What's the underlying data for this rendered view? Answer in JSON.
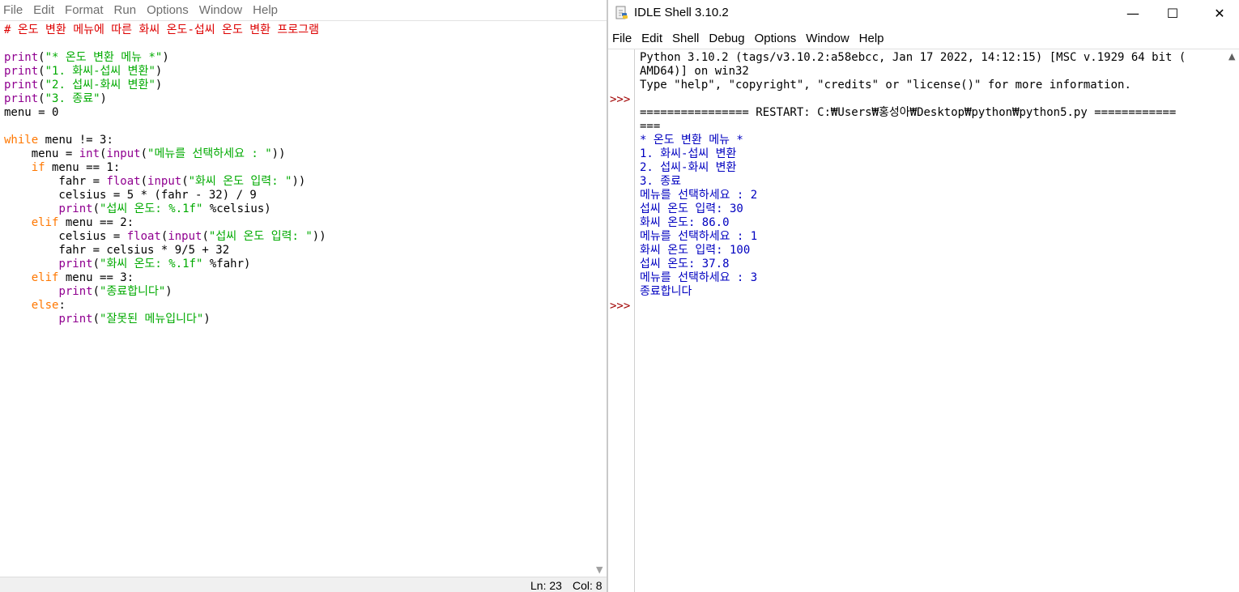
{
  "editor": {
    "menu": [
      "File",
      "Edit",
      "Format",
      "Run",
      "Options",
      "Window",
      "Help"
    ],
    "lines": [
      [
        {
          "t": "# 온도 변환 메뉴에 따른 화씨 온도-섭씨 온도 변환 프로그램",
          "c": "cm"
        }
      ],
      [],
      [
        {
          "t": "print",
          "c": "bi"
        },
        {
          "t": "(",
          "c": "df"
        },
        {
          "t": "\"* 온도 변환 메뉴 *\"",
          "c": "st"
        },
        {
          "t": ")",
          "c": "df"
        }
      ],
      [
        {
          "t": "print",
          "c": "bi"
        },
        {
          "t": "(",
          "c": "df"
        },
        {
          "t": "\"1. 화씨-섭씨 변환\"",
          "c": "st"
        },
        {
          "t": ")",
          "c": "df"
        }
      ],
      [
        {
          "t": "print",
          "c": "bi"
        },
        {
          "t": "(",
          "c": "df"
        },
        {
          "t": "\"2. 섭씨-화씨 변환\"",
          "c": "st"
        },
        {
          "t": ")",
          "c": "df"
        }
      ],
      [
        {
          "t": "print",
          "c": "bi"
        },
        {
          "t": "(",
          "c": "df"
        },
        {
          "t": "\"3. 종료\"",
          "c": "st"
        },
        {
          "t": ")",
          "c": "df"
        }
      ],
      [
        {
          "t": "menu = 0",
          "c": "df"
        }
      ],
      [],
      [
        {
          "t": "while",
          "c": "kw"
        },
        {
          "t": " menu != 3:",
          "c": "df"
        }
      ],
      [
        {
          "t": "    menu = ",
          "c": "df"
        },
        {
          "t": "int",
          "c": "bi"
        },
        {
          "t": "(",
          "c": "df"
        },
        {
          "t": "input",
          "c": "bi"
        },
        {
          "t": "(",
          "c": "df"
        },
        {
          "t": "\"메뉴를 선택하세요 : \"",
          "c": "st"
        },
        {
          "t": "))",
          "c": "df"
        }
      ],
      [
        {
          "t": "    ",
          "c": "df"
        },
        {
          "t": "if",
          "c": "kw"
        },
        {
          "t": " menu == 1:",
          "c": "df"
        }
      ],
      [
        {
          "t": "        fahr = ",
          "c": "df"
        },
        {
          "t": "float",
          "c": "bi"
        },
        {
          "t": "(",
          "c": "df"
        },
        {
          "t": "input",
          "c": "bi"
        },
        {
          "t": "(",
          "c": "df"
        },
        {
          "t": "\"화씨 온도 입력: \"",
          "c": "st"
        },
        {
          "t": "))",
          "c": "df"
        }
      ],
      [
        {
          "t": "        celsius = 5 * (fahr - 32) / 9",
          "c": "df"
        }
      ],
      [
        {
          "t": "        ",
          "c": "df"
        },
        {
          "t": "print",
          "c": "bi"
        },
        {
          "t": "(",
          "c": "df"
        },
        {
          "t": "\"섭씨 온도: %.1f\"",
          "c": "st"
        },
        {
          "t": " %celsius)",
          "c": "df"
        }
      ],
      [
        {
          "t": "    ",
          "c": "df"
        },
        {
          "t": "elif",
          "c": "kw"
        },
        {
          "t": " menu == 2:",
          "c": "df"
        }
      ],
      [
        {
          "t": "        celsius = ",
          "c": "df"
        },
        {
          "t": "float",
          "c": "bi"
        },
        {
          "t": "(",
          "c": "df"
        },
        {
          "t": "input",
          "c": "bi"
        },
        {
          "t": "(",
          "c": "df"
        },
        {
          "t": "\"섭씨 온도 입력: \"",
          "c": "st"
        },
        {
          "t": "))",
          "c": "df"
        }
      ],
      [
        {
          "t": "        fahr = celsius * 9/5 + 32",
          "c": "df"
        }
      ],
      [
        {
          "t": "        ",
          "c": "df"
        },
        {
          "t": "print",
          "c": "bi"
        },
        {
          "t": "(",
          "c": "df"
        },
        {
          "t": "\"화씨 온도: %.1f\"",
          "c": "st"
        },
        {
          "t": " %fahr)",
          "c": "df"
        }
      ],
      [
        {
          "t": "    ",
          "c": "df"
        },
        {
          "t": "elif",
          "c": "kw"
        },
        {
          "t": " menu == 3:",
          "c": "df"
        }
      ],
      [
        {
          "t": "        ",
          "c": "df"
        },
        {
          "t": "print",
          "c": "bi"
        },
        {
          "t": "(",
          "c": "df"
        },
        {
          "t": "\"종료합니다\"",
          "c": "st"
        },
        {
          "t": ")",
          "c": "df"
        }
      ],
      [
        {
          "t": "    ",
          "c": "df"
        },
        {
          "t": "else",
          "c": "kw"
        },
        {
          "t": ":",
          "c": "df"
        }
      ],
      [
        {
          "t": "        ",
          "c": "df"
        },
        {
          "t": "print",
          "c": "bi"
        },
        {
          "t": "(",
          "c": "df"
        },
        {
          "t": "\"잘못된 메뉴입니다\"",
          "c": "st"
        },
        {
          "t": ")",
          "c": "df"
        }
      ]
    ],
    "status": {
      "ln": "Ln: 23",
      "col": "Col: 8"
    }
  },
  "shell": {
    "title": "IDLE Shell 3.10.2",
    "window_buttons": {
      "minimize": "—",
      "maximize": "☐",
      "close": "✕"
    },
    "menu": [
      "File",
      "Edit",
      "Shell",
      "Debug",
      "Options",
      "Window",
      "Help"
    ],
    "prompt_symbol": ">>>",
    "lines": [
      {
        "t": "Python 3.10.2 (tags/v3.10.2:a58ebcc, Jan 17 2022, 14:12:15) [MSC v.1929 64 bit (",
        "c": "info"
      },
      {
        "t": "AMD64)] on win32",
        "c": "info"
      },
      {
        "t": "Type \"help\", \"copyright\", \"credits\" or \"license()\" for more information.",
        "c": "info"
      },
      {
        "t": "",
        "c": "info"
      },
      {
        "t": "================ RESTART: C:₩Users₩홍성아₩Desktop₩python₩python5.py ============",
        "c": "info"
      },
      {
        "t": "===",
        "c": "info"
      },
      {
        "t": "* 온도 변환 메뉴 *",
        "c": "out"
      },
      {
        "t": "1. 화씨-섭씨 변환",
        "c": "out"
      },
      {
        "t": "2. 섭씨-화씨 변환",
        "c": "out"
      },
      {
        "t": "3. 종료",
        "c": "out"
      },
      {
        "t": "메뉴를 선택하세요 : 2",
        "c": "out"
      },
      {
        "t": "섭씨 온도 입력: 30",
        "c": "out"
      },
      {
        "t": "화씨 온도: 86.0",
        "c": "out"
      },
      {
        "t": "메뉴를 선택하세요 : 1",
        "c": "out"
      },
      {
        "t": "화씨 온도 입력: 100",
        "c": "out"
      },
      {
        "t": "섭씨 온도: 37.8",
        "c": "out"
      },
      {
        "t": "메뉴를 선택하세요 : 3",
        "c": "out"
      },
      {
        "t": "종료합니다",
        "c": "out"
      }
    ],
    "prompt_line_indices": [
      3,
      18
    ]
  }
}
